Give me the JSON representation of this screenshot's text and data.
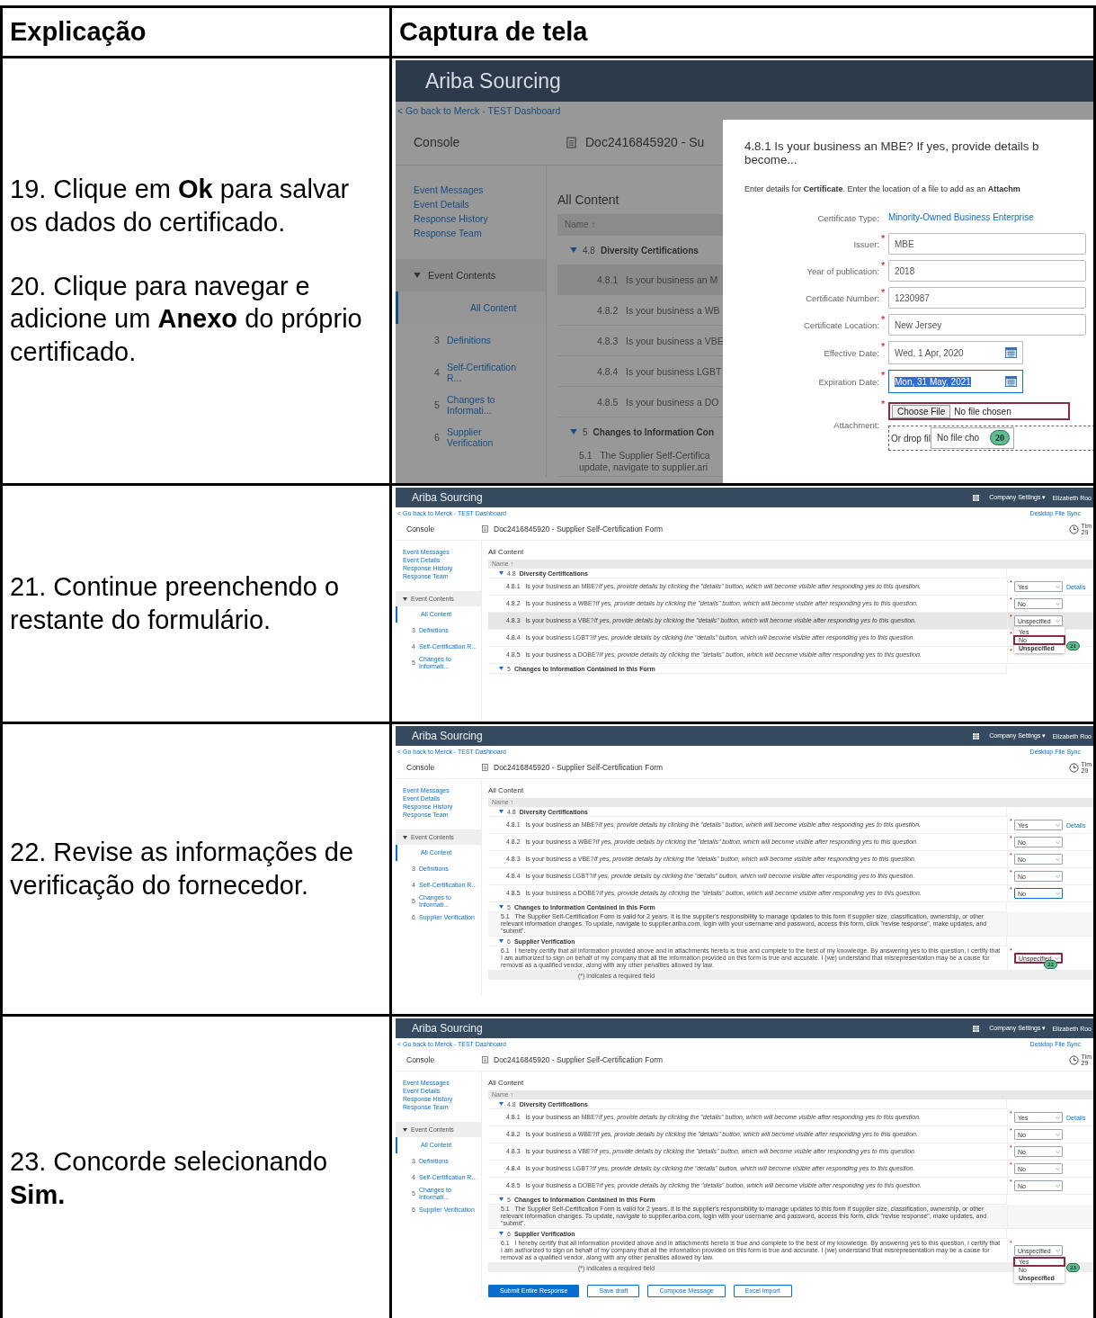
{
  "header": {
    "columns": [
      "Explicação",
      "Captura de tela"
    ]
  },
  "steps": [
    {
      "paragraphs": [
        "19. Clique em **Ok** para salvar os dados do certificado.",
        "20. Clique para navegar e adicione um **Anexo** do próprio certificado."
      ],
      "screen": {
        "kind": "dialog",
        "app_title": "Ariba Sourcing",
        "back_link": "< Go back to Merck - TEST Dashboard",
        "console": "Console",
        "doc_title": "Doc2416845920 - Su",
        "sidebar_links": [
          "Event Messages",
          "Event Details",
          "Response History",
          "Response Team"
        ],
        "event_contents": "Event Contents",
        "nav": [
          {
            "label": "All Content",
            "selected": true
          },
          {
            "number": "3",
            "label": "Definitions",
            "selected": false
          },
          {
            "number": "4",
            "label": "Self-Certification R...",
            "selected": false
          },
          {
            "number": "5",
            "label": "Changes to Informati...",
            "selected": false
          },
          {
            "number": "6",
            "label": "Supplier Verification",
            "selected": false
          }
        ],
        "content_title": "All Content",
        "name_header": "Name ↑",
        "sections": [
          {
            "number": "4.8",
            "title": "Diversity Certifications",
            "items": [
              {
                "number": "4.8.1",
                "text": "Is your business an M",
                "hovered": true
              },
              {
                "number": "4.8.2",
                "text": "Is your business a WB",
                "hovered": false
              },
              {
                "number": "4.8.3",
                "text": "Is your business a VBE",
                "hovered": false
              },
              {
                "number": "4.8.4",
                "text": "Is your business LGBT",
                "hovered": false
              },
              {
                "number": "4.8.5",
                "text": "Is your business a DO",
                "hovered": false
              }
            ]
          },
          {
            "number": "5",
            "title": "Changes to Information Con",
            "items": [
              {
                "number": "5.1",
                "text": "The Supplier Self-Certifica",
                "continued": "update, navigate to supplier.ari",
                "hovered": false
              }
            ]
          }
        ],
        "dialog": {
          "title_lines": [
            "4.8.1 Is your business an MBE? If yes, provide details b",
            "become..."
          ],
          "intro": "Enter details for **Certificate**. Enter the location of a file to add as an **Attachm**",
          "fields": [
            {
              "kind": "link",
              "label": "Certificate Type:",
              "value": "Minority-Owned Business Enterprise"
            },
            {
              "kind": "text",
              "label": "Issuer:",
              "required_mark": "*",
              "value": "MBE"
            },
            {
              "kind": "text",
              "label": "Year of publication:",
              "required_mark": "*",
              "value": "2018"
            },
            {
              "kind": "text",
              "label": "Certificate Number:",
              "required_mark": "*",
              "value": "1230987"
            },
            {
              "kind": "text",
              "label": "Certificate Location:",
              "required_mark": "*",
              "value": "New Jersey"
            },
            {
              "kind": "date",
              "label": "Effective Date:",
              "required_mark": "*",
              "value": "Wed, 1 Apr, 2020",
              "selected": false
            },
            {
              "kind": "date",
              "label": "Expiration Date:",
              "required_mark": "*",
              "value": "Mon, 31 May, 2021",
              "selected": true
            },
            {
              "kind": "file",
              "label": "Attachment:",
              "required_mark": "*",
              "button": "Choose File",
              "value": "No file chosen",
              "highlighted": true,
              "drop_label": "Or drop fil",
              "drop_value": "No file cho",
              "callout": "20"
            }
          ]
        }
      }
    },
    {
      "paragraphs": [
        "21. Continue preenchendo o restante do formulário."
      ],
      "screen": {
        "kind": "form",
        "app_title": "Ariba Sourcing",
        "header_menu": "Company Settings ▾",
        "user": "Elizabeth Roo",
        "back_link": "< Go back to Merck - TEST Dashboard",
        "desktop_sync": "Desktop File Sync",
        "console": "Console",
        "doc_title": "Doc2416845920 - Supplier Self-Certification Form",
        "time_label": "Tim",
        "time_value": "29",
        "sidebar_links": [
          "Event Messages",
          "Event Details",
          "Response History",
          "Response Team"
        ],
        "event_contents": "Event Contents",
        "nav": [
          {
            "label": "All Content",
            "selected": true
          },
          {
            "number": "3",
            "label": "Definitions",
            "selected": false
          },
          {
            "number": "4",
            "label": "Self-Certification R...",
            "selected": false
          },
          {
            "number": "5",
            "label": "Changes to Informati...",
            "selected": false
          }
        ],
        "content_title": "All Content",
        "name_header": "Name ↑",
        "sections": [
          {
            "number": "4.8",
            "title": "Diversity Certifications",
            "items": [
              {
                "number": "4.8.1",
                "text": "Is your business an MBE?",
                "hint": "If yes, provide details by clicking the \"details\" button, which will become visible after responding yes to this question.",
                "required_mark": "*",
                "answer": "Yes",
                "details": "Details",
                "hovered": false,
                "highlighted": false
              },
              {
                "number": "4.8.2",
                "text": "Is your business a WBE?",
                "hint": "If yes, provide details by clicking the \"details\" button, which will become visible after responding yes to this question.",
                "required_mark": "*",
                "answer": "No",
                "hovered": false,
                "highlighted": false
              },
              {
                "number": "4.8.3",
                "text": "Is your business a VBE?",
                "hint": "If yes, provide details by clicking the \"details\" button, which will become visible after responding yes to this question.",
                "required_mark": "*",
                "answer": "Unspecified",
                "hovered": true,
                "highlighted": false,
                "callout": "21",
                "menu": [
                  {
                    "label": "Yes",
                    "current": false,
                    "highlighted": false
                  },
                  {
                    "label": "No",
                    "current": false,
                    "highlighted": true
                  },
                  {
                    "label": "Unspecified",
                    "current": true,
                    "highlighted": false
                  }
                ]
              },
              {
                "number": "4.8.4",
                "text": "Is your business LGBT?",
                "hint": "If yes, provide details by clicking the \"details\" button, which will become visible after responding yes to this question.",
                "required_mark": "*",
                "hovered": false
              },
              {
                "number": "4.8.5",
                "text": "Is your business a DOBE?",
                "hint": "If yes, provide details by clicking the \"details\" button, which will become visible after responding yes to this question.",
                "required_mark": "*",
                "hovered": false
              }
            ]
          },
          {
            "number": "5",
            "title": "Changes to Information Contained in this Form"
          }
        ]
      }
    },
    {
      "paragraphs": [
        "22. Revise as informações de verificação do fornecedor."
      ],
      "screen": {
        "kind": "form",
        "app_title": "Ariba Sourcing",
        "header_menu": "Company Settings ▾",
        "user": "Elizabeth Roo",
        "back_link": "< Go back to Merck - TEST Dashboard",
        "desktop_sync": "Desktop File Sync",
        "console": "Console",
        "doc_title": "Doc2416845920 - Supplier Self-Certification Form",
        "time_label": "Tim",
        "time_value": "29",
        "sidebar_links": [
          "Event Messages",
          "Event Details",
          "Response History",
          "Response Team"
        ],
        "event_contents": "Event Contents",
        "nav": [
          {
            "label": "All Content",
            "selected": true
          },
          {
            "number": "3",
            "label": "Definitions",
            "selected": false
          },
          {
            "number": "4",
            "label": "Self-Certification R...",
            "selected": false
          },
          {
            "number": "5",
            "label": "Changes to Informati...",
            "selected": false
          },
          {
            "number": "6",
            "label": "Supplier Verification",
            "selected": false
          }
        ],
        "content_title": "All Content",
        "name_header": "Name ↑",
        "sections": [
          {
            "number": "4.8",
            "title": "Diversity Certifications",
            "items": [
              {
                "number": "4.8.1",
                "text": "Is your business an MBE?",
                "hint": "If yes, provide details by clicking the \"details\" button, which will become visible after responding yes to this question.",
                "required_mark": "*",
                "answer": "Yes",
                "details": "Details",
                "hovered": false,
                "highlighted": false
              },
              {
                "number": "4.8.2",
                "text": "Is your business a WBE?",
                "hint": "If yes, provide details by clicking the \"details\" button, which will become visible after responding yes to this question.",
                "required_mark": "*",
                "answer": "No",
                "hovered": false,
                "highlighted": false
              },
              {
                "number": "4.8.3",
                "text": "Is your business a VBE?",
                "hint": "If yes, provide details by clicking the \"details\" button, which will become visible after responding yes to this question.",
                "required_mark": "*",
                "answer": "No",
                "hovered": false,
                "highlighted": false
              },
              {
                "number": "4.8.4",
                "text": "Is your business LGBT?",
                "hint": "If yes, provide details by clicking the \"details\" button, which will become visible after responding yes to this question.",
                "required_mark": "*",
                "answer": "No",
                "hovered": false,
                "highlighted": false
              },
              {
                "number": "4.8.5",
                "text": "Is your business a DOBE?",
                "hint": "If yes, provide details by clicking the \"details\" button, which will become visible after responding yes to this question.",
                "required_mark": "*",
                "answer": "No",
                "hovered": false,
                "highlighted": false,
                "focused": true
              }
            ]
          },
          {
            "number": "5",
            "title": "Changes to Information Contained in this Form",
            "items": [
              {
                "number": "5.1",
                "text": "The Supplier Self-Certification Form is valid for 2 years. It is the supplier's responsibility to manage updates to this form if supplier size, classification, ownership, or other relevant information changes. To update, navigate to supplier.ariba.com, login with your username and password, access this form, click \"revise response\", make updates, and \"submit\".",
                "hovered": false
              }
            ]
          },
          {
            "number": "6",
            "title": "Supplier Verification",
            "items": [
              {
                "number": "6.1",
                "text": "I hereby certify that all information provided above and in attachments hereto is true and complete to the best of my knowledge. By answering yes to this question, I certify that I am authorized to sign on behalf of my company that all the information provided on this form is true and accurate. I (we) understand that misrepresentation may be a cause for removal as a qualified vendor, along with any other penalties allowed by law.",
                "required_mark": "*",
                "answer": "Unspecified",
                "hovered": false,
                "highlighted": true,
                "callout": "22"
              }
            ]
          }
        ],
        "footer_note": "(*) indicates a required field"
      }
    },
    {
      "paragraphs": [
        "23. Concorde selecionando **Sim.**"
      ],
      "screen": {
        "kind": "form",
        "app_title": "Ariba Sourcing",
        "header_menu": "Company Settings ▾",
        "user": "Elizabeth Roo",
        "back_link": "< Go back to Merck - TEST Dashboard",
        "desktop_sync": "Desktop File Sync",
        "console": "Console",
        "doc_title": "Doc2416845920 - Supplier Self-Certification Form",
        "time_label": "Tim",
        "time_value": "29",
        "sidebar_links": [
          "Event Messages",
          "Event Details",
          "Response History",
          "Response Team"
        ],
        "event_contents": "Event Contents",
        "nav": [
          {
            "label": "All Content",
            "selected": true
          },
          {
            "number": "3",
            "label": "Definitions",
            "selected": false
          },
          {
            "number": "4",
            "label": "Self-Certification R...",
            "selected": false
          },
          {
            "number": "5",
            "label": "Changes to Informati...",
            "selected": false
          },
          {
            "number": "6",
            "label": "Supplier Verification",
            "selected": false
          }
        ],
        "content_title": "All Content",
        "name_header": "Name ↑",
        "sections": [
          {
            "number": "4.8",
            "title": "Diversity Certifications",
            "items": [
              {
                "number": "4.8.1",
                "text": "Is your business an MBE?",
                "hint": "If yes, provide details by clicking the \"details\" button, which will become visible after responding yes to this question.",
                "required_mark": "*",
                "answer": "Yes",
                "details": "Details",
                "hovered": false,
                "highlighted": false
              },
              {
                "number": "4.8.2",
                "text": "Is your business a WBE?",
                "hint": "If yes, provide details by clicking the \"details\" button, which will become visible after responding yes to this question.",
                "required_mark": "*",
                "answer": "No",
                "hovered": false,
                "highlighted": false
              },
              {
                "number": "4.8.3",
                "text": "Is your business a VBE?",
                "hint": "If yes, provide details by clicking the \"details\" button, which will become visible after responding yes to this question.",
                "required_mark": "*",
                "answer": "No",
                "hovered": false,
                "highlighted": false
              },
              {
                "number": "4.8.4",
                "text": "Is your business LGBT?",
                "hint": "If yes, provide details by clicking the \"details\" button, which will become visible after responding yes to this question.",
                "required_mark": "*",
                "answer": "No",
                "hovered": false,
                "highlighted": false
              },
              {
                "number": "4.8.5",
                "text": "Is your business a DOBE?",
                "hint": "If yes, provide details by clicking the \"details\" button, which will become visible after responding yes to this question.",
                "required_mark": "*",
                "answer": "No",
                "hovered": false,
                "highlighted": false
              }
            ]
          },
          {
            "number": "5",
            "title": "Changes to Information Contained in this Form",
            "items": [
              {
                "number": "5.1",
                "text": "The Supplier Self-Certification Form is valid for 2 years. It is the supplier's responsibility to manage updates to this form if supplier size, classification, ownership, or other relevant information changes. To update, navigate to supplier.ariba.com, login with your username and password, access this form, click \"revise response\", make updates, and \"submit\".",
                "hovered": false
              }
            ]
          },
          {
            "number": "6",
            "title": "Supplier Verification",
            "items": [
              {
                "number": "6.1",
                "text": "I hereby certify that all information provided above and in attachments hereto is true and complete to the best of my knowledge. By answering yes to this question, I certify that I am authorized to sign on behalf of my company that all the information provided on this form is true and accurate. I (we) understand that misrepresentation may be a cause for removal as a qualified vendor, along with any other penalties allowed by law.",
                "required_mark": "*",
                "answer": "Unspecified",
                "hovered": false,
                "highlighted": false,
                "callout": "23",
                "menu": [
                  {
                    "label": "Yes",
                    "current": false,
                    "highlighted": true
                  },
                  {
                    "label": "No",
                    "current": false,
                    "highlighted": false
                  },
                  {
                    "label": "Unspecified",
                    "current": true,
                    "highlighted": false
                  }
                ]
              }
            ]
          }
        ],
        "footer_note": "(*) indicates a required field",
        "buttons": [
          {
            "label": "Submit Entire Response",
            "primary": true
          },
          {
            "label": "Save draft",
            "primary": false
          },
          {
            "label": "Compose Message",
            "primary": false
          },
          {
            "label": "Excel Import",
            "primary": false
          }
        ]
      }
    }
  ]
}
